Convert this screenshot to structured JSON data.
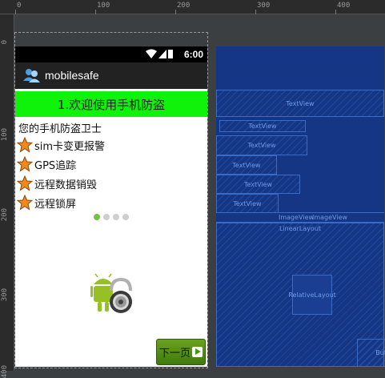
{
  "ruler": {
    "top_ticks": [
      "0",
      "100",
      "200",
      "300",
      "400"
    ],
    "left_ticks": [
      "0",
      "100",
      "200",
      "300",
      "400"
    ]
  },
  "status_bar": {
    "time": "6:00"
  },
  "app": {
    "title": "mobilesafe"
  },
  "banner": {
    "title": "1.欢迎使用手机防盗"
  },
  "subtitle": "您的手机防盗卫士",
  "features": [
    "sim卡变更报警",
    "GPS追踪",
    "远程数据销毁",
    "远程锁屏"
  ],
  "pager": {
    "count": 4,
    "active_index": 0
  },
  "next_button": {
    "label": "下一页"
  },
  "blueprint": {
    "textview": "TextView",
    "imageview": "ImageView",
    "linearlayout": "LinearLayout",
    "relativelayout": "RelativeLayout",
    "button_partial": "But"
  },
  "colors": {
    "banner": "#0ff20a",
    "blueprint_bg": "#143684",
    "active_dot": "#76c043",
    "next_button": "#4f8a15"
  }
}
